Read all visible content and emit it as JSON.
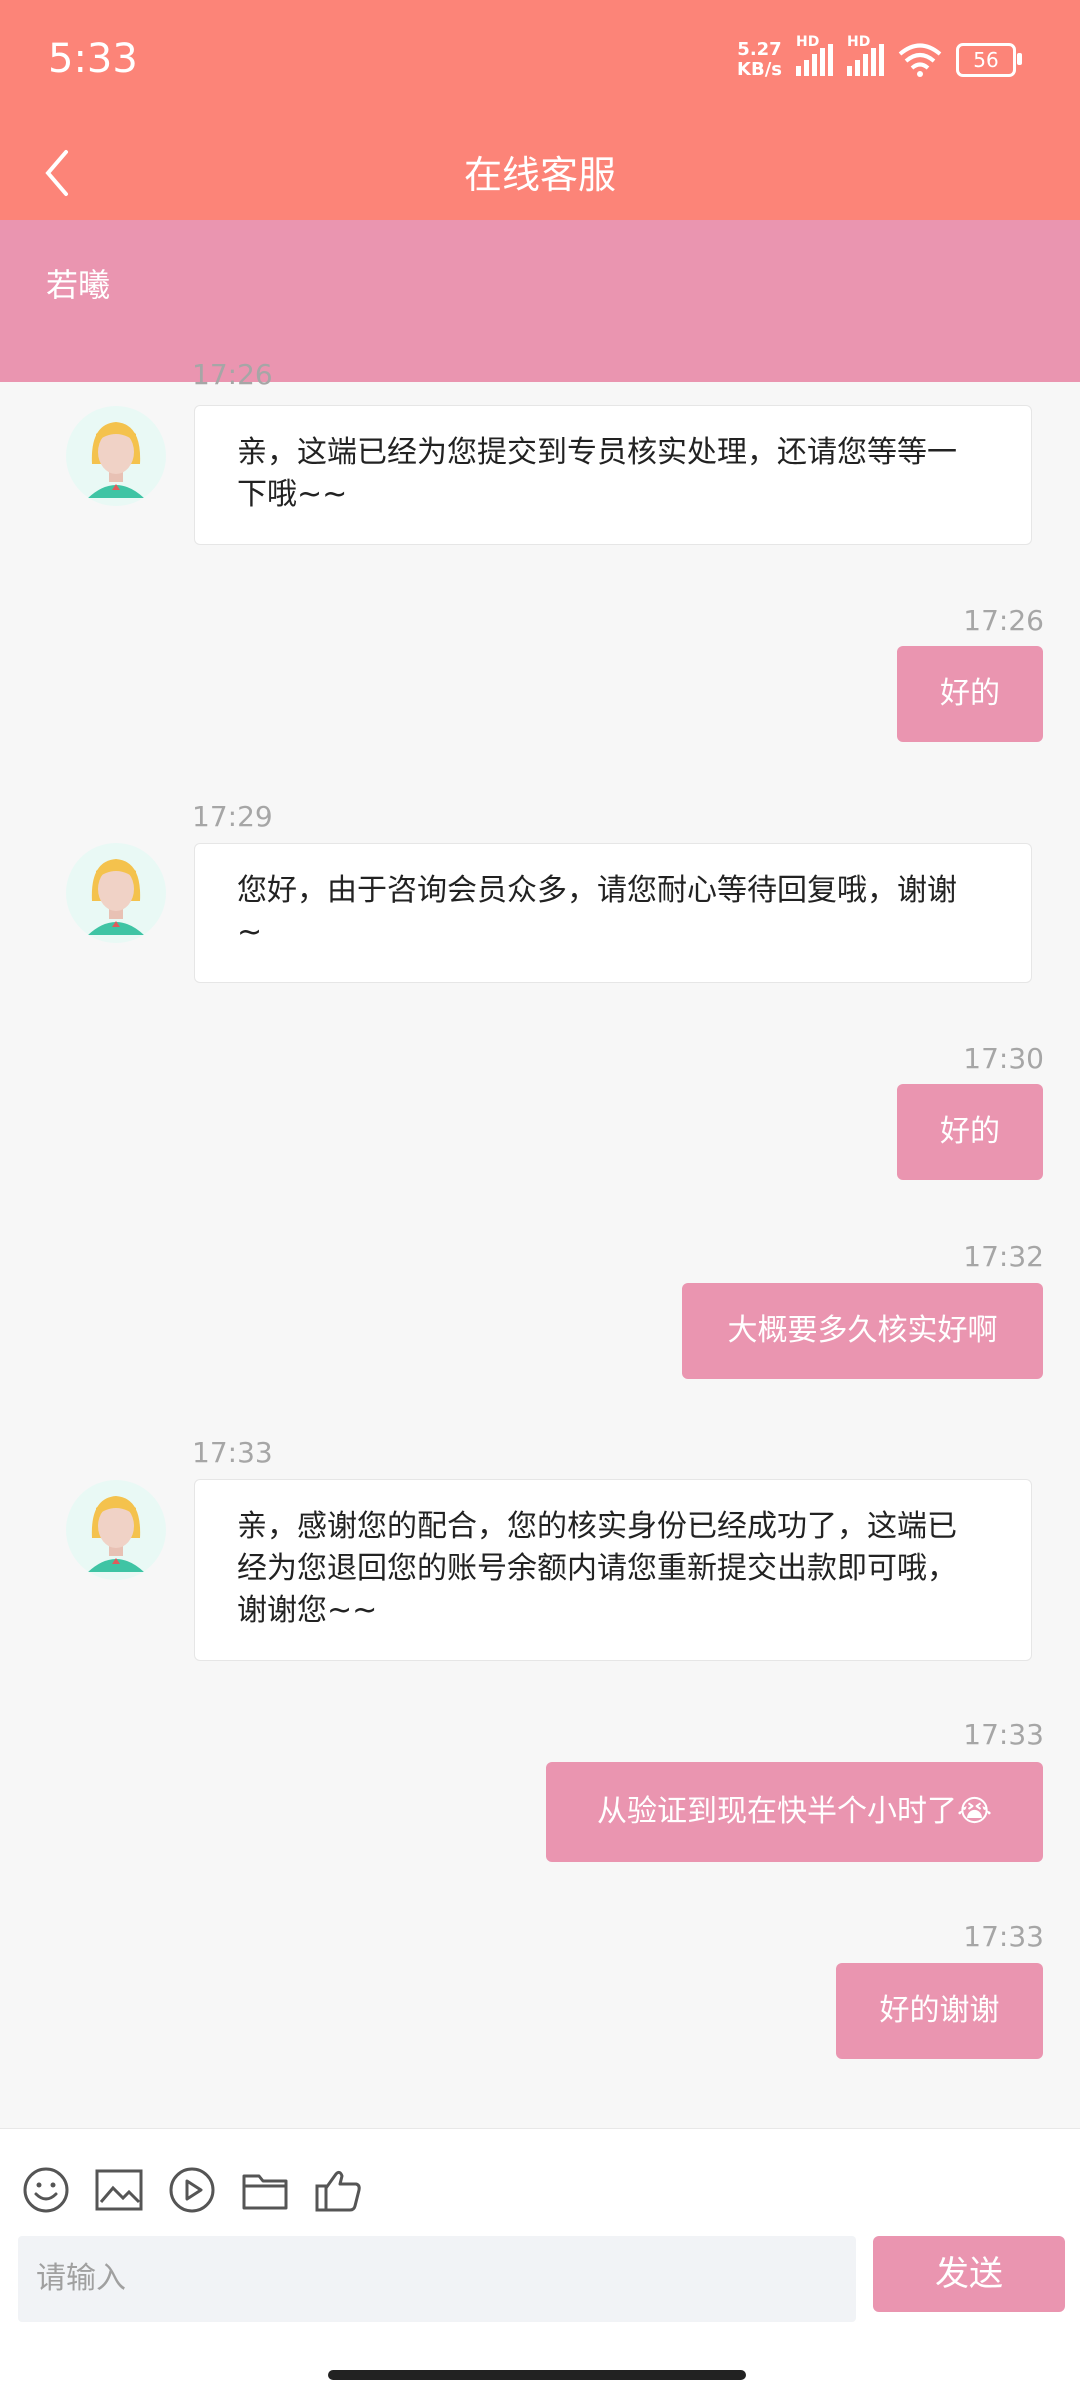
{
  "status_bar": {
    "time": "5:33",
    "net_speed_value": "5.27",
    "net_speed_unit": "KB/s",
    "hd_1": "HD",
    "hd_2": "HD",
    "battery": "56"
  },
  "app_bar": {
    "title": "在线客服",
    "back_icon": "chevron-left-icon"
  },
  "agent": {
    "name": "若曦"
  },
  "messages": [
    {
      "time": "17:26",
      "text_line1": "亲，这端已经为您提交到专员核实处理，还请您等等一",
      "text_line2": "下哦~~"
    },
    {
      "time": "17:26",
      "text": "好的"
    },
    {
      "time": "17:29",
      "text_line1": "您好，由于咨询会员众多，请您耐心等待回复哦，谢谢",
      "text_line2": "~"
    },
    {
      "time": "17:30",
      "text": "好的"
    },
    {
      "time": "17:32",
      "text": "大概要多久核实好啊"
    },
    {
      "time": "17:33",
      "text_line1": "亲，感谢您的配合，您的核实身份已经成功了，这端已",
      "text_line2": "经为您退回您的账号余额内请您重新提交出款即可哦，",
      "text_line3": "谢谢您~~"
    },
    {
      "time": "17:33",
      "text": "从验证到现在快半个小时了😭"
    },
    {
      "time": "17:33",
      "text": "好的谢谢"
    }
  ],
  "toolbar": {
    "icons": [
      "smile-icon",
      "image-icon",
      "video-icon",
      "folder-icon",
      "thumbs-up-icon"
    ]
  },
  "input": {
    "placeholder": "请输入",
    "send_label": "发送"
  },
  "colors": {
    "header": "#fc8478",
    "accent": "#ea95b0"
  }
}
